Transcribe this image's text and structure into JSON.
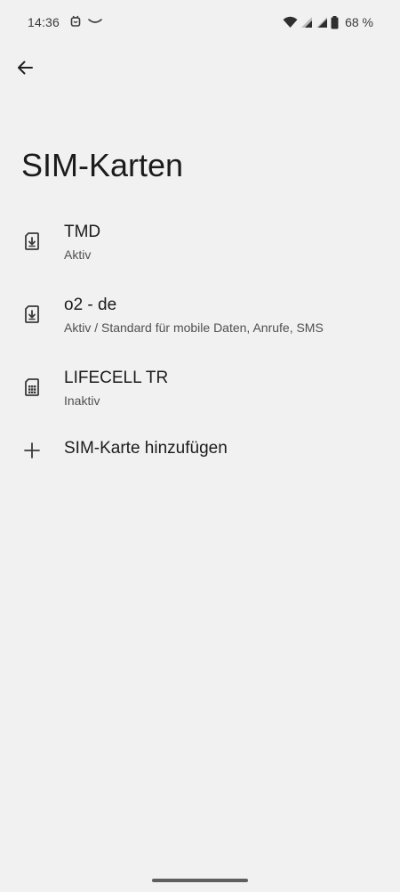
{
  "status_bar": {
    "time": "14:36",
    "battery_percent": "68 %",
    "icons": [
      "notification-app-icon",
      "notification-wave-icon",
      "wifi-icon",
      "signal-icon",
      "signal-icon",
      "battery-icon"
    ]
  },
  "header": {
    "back_icon": "arrow-back-icon",
    "title": "SIM-Karten"
  },
  "sims": [
    {
      "name": "TMD",
      "status": "Aktiv",
      "icon": "esim-download-icon"
    },
    {
      "name": "o2 - de",
      "status": "Aktiv / Standard für mobile Daten, Anrufe, SMS",
      "icon": "esim-download-icon"
    },
    {
      "name": "LIFECELL TR",
      "status": "Inaktiv",
      "icon": "sim-card-icon"
    }
  ],
  "add_sim": {
    "label": "SIM-Karte hinzufügen",
    "icon": "plus-icon"
  },
  "colors": {
    "background": "#f1f1f1",
    "text_primary": "#1b1b1b",
    "text_secondary": "#505050"
  }
}
